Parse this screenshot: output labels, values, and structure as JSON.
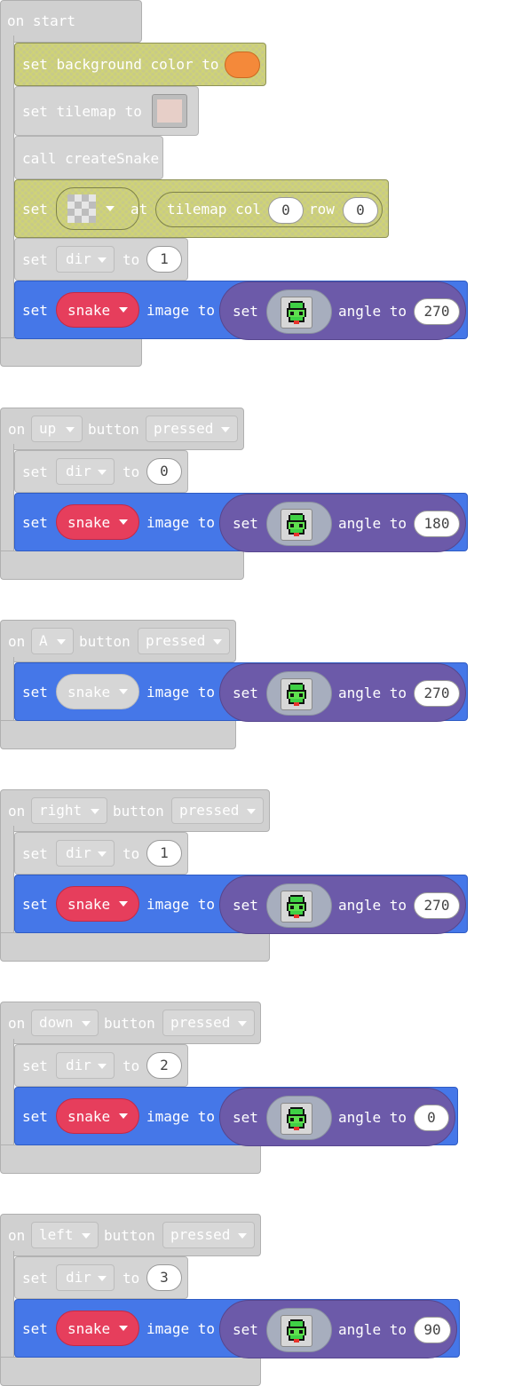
{
  "on_start": {
    "header": "on start",
    "bg_label": "set background color to",
    "bg_color": "#f4893a",
    "tilemap_label": "set tilemap to",
    "call_label": "call createSnake",
    "place_set": "set",
    "place_at": "at",
    "tilemap_col": "tilemap col",
    "col_value": "0",
    "row_label": "row",
    "row_value": "0",
    "dir_set": "set",
    "dir_var": "dir",
    "dir_to": "to",
    "dir_value": "1",
    "snake_set": "set",
    "snake_var": "snake",
    "image_to": "image to",
    "inner_set": "set",
    "angle_to": "angle to",
    "angle": "270"
  },
  "handlers": [
    {
      "on": "on",
      "button": "up",
      "button_word": "button",
      "event": "pressed",
      "set": "set",
      "dir_var": "dir",
      "to": "to",
      "dir_value": "0",
      "snake_set": "set",
      "snake_var": "snake",
      "image_to": "image to",
      "inner_set": "set",
      "angle_to": "angle to",
      "angle": "180"
    },
    {
      "on": "on",
      "button": "A",
      "button_word": "button",
      "event": "pressed",
      "snake_set": "set",
      "snake_var": "snake",
      "image_to": "image to",
      "inner_set": "set",
      "angle_to": "angle to",
      "angle": "270"
    },
    {
      "on": "on",
      "button": "right",
      "button_word": "button",
      "event": "pressed",
      "set": "set",
      "dir_var": "dir",
      "to": "to",
      "dir_value": "1",
      "snake_set": "set",
      "snake_var": "snake",
      "image_to": "image to",
      "inner_set": "set",
      "angle_to": "angle to",
      "angle": "270"
    },
    {
      "on": "on",
      "button": "down",
      "button_word": "button",
      "event": "pressed",
      "set": "set",
      "dir_var": "dir",
      "to": "to",
      "dir_value": "2",
      "snake_set": "set",
      "snake_var": "snake",
      "image_to": "image to",
      "inner_set": "set",
      "angle_to": "angle to",
      "angle": "0"
    },
    {
      "on": "on",
      "button": "left",
      "button_word": "button",
      "event": "pressed",
      "set": "set",
      "dir_var": "dir",
      "to": "to",
      "dir_value": "3",
      "snake_set": "set",
      "snake_var": "snake",
      "image_to": "image to",
      "inner_set": "set",
      "angle_to": "angle to",
      "angle": "90"
    }
  ],
  "colors": {
    "event_block": "#d0d0d0",
    "sprites_block": "#4577e8",
    "image_block": "#6c5aa9",
    "snake_variable": "#e63e5c",
    "scene_block": "#c7c98a"
  },
  "icons": {
    "snake_head": "green-snake-head-sprite",
    "transparent_image": "checkerboard-image"
  }
}
